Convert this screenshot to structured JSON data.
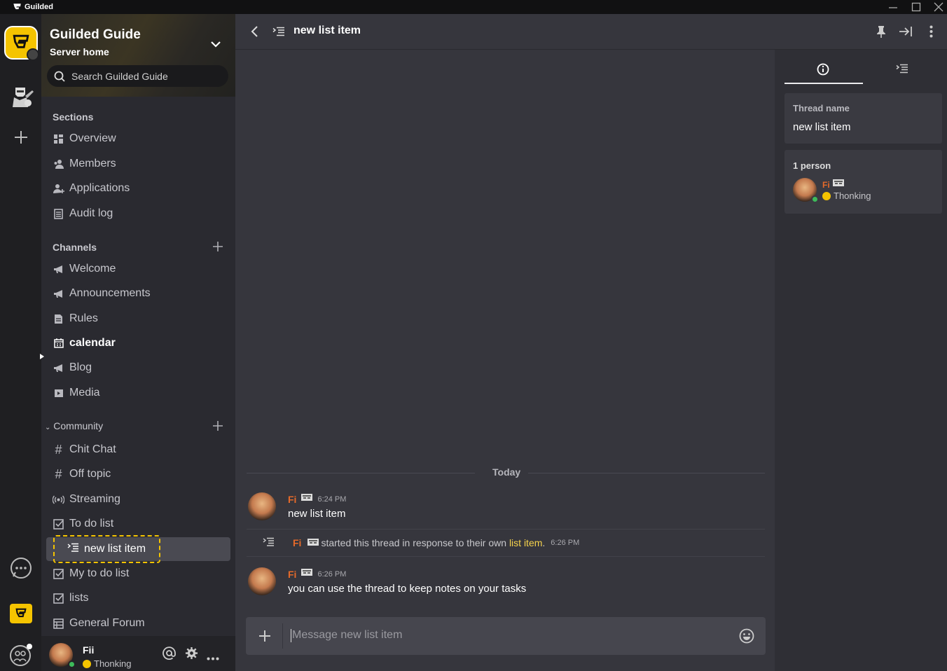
{
  "app": {
    "title": "Guilded",
    "colors": {
      "accent": "#f5c400",
      "name": "#e56a2a",
      "link": "#f5d24c",
      "online": "#3dbb5a"
    }
  },
  "window": {
    "minimize_icon": "minimize-icon",
    "maximize_icon": "maximize-icon",
    "close_icon": "close-icon"
  },
  "server": {
    "name": "Guilded Guide",
    "subtitle": "Server home",
    "search_placeholder": "Search Guilded Guide"
  },
  "sections": {
    "label": "Sections",
    "items": [
      {
        "label": "Overview",
        "icon": "overview-icon"
      },
      {
        "label": "Members",
        "icon": "members-icon"
      },
      {
        "label": "Applications",
        "icon": "applications-icon"
      },
      {
        "label": "Audit log",
        "icon": "audit-log-icon"
      }
    ]
  },
  "channels": {
    "label": "Channels",
    "items": [
      {
        "label": "Welcome",
        "icon": "megaphone-icon"
      },
      {
        "label": "Announcements",
        "icon": "megaphone-icon"
      },
      {
        "label": "Rules",
        "icon": "document-icon"
      },
      {
        "label": "calendar",
        "icon": "calendar-icon"
      },
      {
        "label": "Blog",
        "icon": "megaphone-icon"
      },
      {
        "label": "Media",
        "icon": "media-icon"
      }
    ]
  },
  "community": {
    "label": "Community",
    "items": [
      {
        "label": "Chit Chat",
        "icon": "hash-icon"
      },
      {
        "label": "Off topic",
        "icon": "hash-icon"
      },
      {
        "label": "Streaming",
        "icon": "stream-icon"
      },
      {
        "label": "To do list",
        "icon": "checkbox-icon"
      },
      {
        "label": "new list item",
        "icon": "thread-icon"
      },
      {
        "label": "My to do list",
        "icon": "checkbox-icon"
      },
      {
        "label": "lists",
        "icon": "checkbox-icon"
      },
      {
        "label": "General Forum",
        "icon": "forum-icon"
      }
    ]
  },
  "user": {
    "name": "Fii",
    "status": "Thonking"
  },
  "thread": {
    "title": "new list item"
  },
  "chat": {
    "date_divider": "Today",
    "messages": [
      {
        "author": "Fi",
        "time": "6:24 PM",
        "text": "new list item"
      },
      {
        "author": "Fi",
        "time": "6:26 PM",
        "text": "you can use the thread to keep notes on your tasks"
      }
    ],
    "system": {
      "author": "Fi",
      "text": "started this thread in response to their own",
      "link": "list item",
      "suffix": ".",
      "time": "6:26 PM"
    },
    "composer_placeholder": "Message new list item"
  },
  "details": {
    "thread_name_label": "Thread name",
    "thread_name": "new list item",
    "people_label": "1 person",
    "member_name": "Fi",
    "member_status": "Thonking"
  }
}
